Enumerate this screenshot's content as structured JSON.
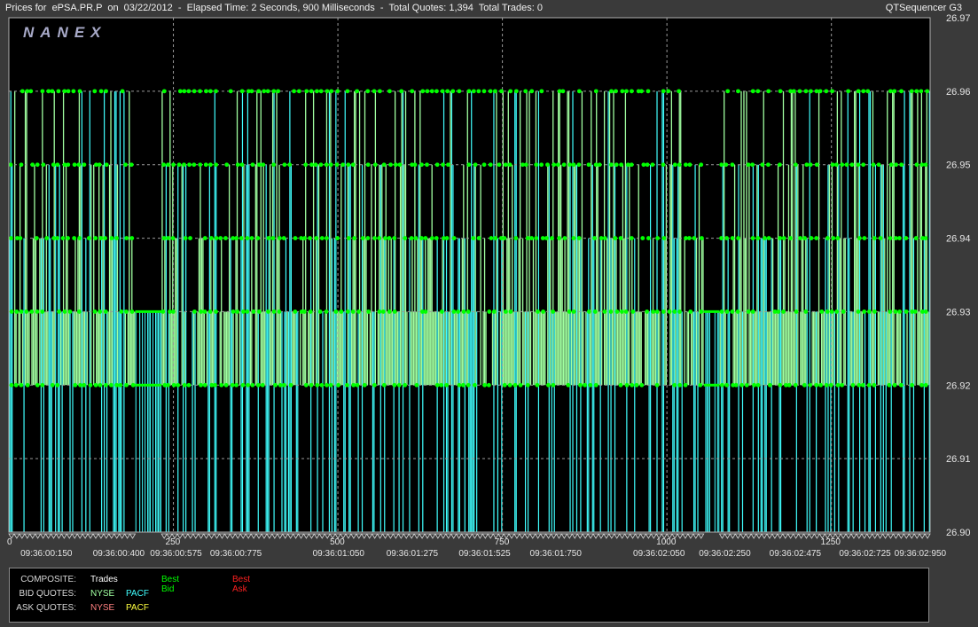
{
  "window": {
    "title": "Prices for  ePSA.PR.P  on  03/22/2012  -  Elapsed Time: 2 Seconds, 900 Milliseconds  -  Total Quotes: 1,394  Total Trades: 0",
    "app_name": "QTSequencer G3"
  },
  "logo_text": "NANEX",
  "colors": {
    "background": "#000000",
    "frame": "#3a3a3a",
    "best_bid": "#00ff00",
    "best_ask": "#ff2020",
    "bid_nyse": "#a0ffa0",
    "bid_pacf": "#40ffff",
    "ask_nyse": "#ff8080",
    "ask_pacf": "#ffff40",
    "grid": "#9a9a9a"
  },
  "chart_data": {
    "type": "line",
    "title": "Prices for  ePSA.PR.P  on  03/22/2012",
    "ylim": [
      26.9,
      26.97
    ],
    "xlim": [
      0,
      1400
    ],
    "y_ticks": [
      "26.97",
      "26.96",
      "26.95",
      "26.94",
      "26.93",
      "26.92",
      "26.91",
      "26.90"
    ],
    "y_tick_values": [
      26.97,
      26.96,
      26.95,
      26.94,
      26.93,
      26.92,
      26.91,
      26.9
    ],
    "x_ticks": [
      "0",
      "250",
      "500",
      "750",
      "1000",
      "1250"
    ],
    "x_tick_values": [
      0,
      250,
      500,
      750,
      1000,
      1250
    ],
    "time_labels": [
      "09:36:00:150",
      "09:36:00:400",
      "09:36:00:575",
      "09:36:00:775",
      "09:36:01:050",
      "09:36:01:275",
      "09:36:01:525",
      "09:36:01:750",
      "09:36:02:050",
      "09:36:02:250",
      "09:36:02:475",
      "09:36:02:725",
      "09:36:02:950"
    ],
    "time_label_positions": [
      57,
      167,
      254,
      345,
      501,
      613,
      723,
      831,
      988,
      1088,
      1195,
      1301,
      1385
    ],
    "best_bid_levels": [
      26.92,
      26.93
    ],
    "quote_levels": [
      26.92,
      26.93,
      26.94,
      26.95,
      26.96
    ],
    "gaps": [
      [
        192,
        232
      ],
      [
        1056,
        1080
      ]
    ],
    "quote_count": 1394,
    "trade_count": 0
  },
  "legend": {
    "composite_label": "COMPOSITE:",
    "bid_label": "BID QUOTES:",
    "ask_label": "ASK QUOTES:",
    "trades": "Trades",
    "best_bid": "Best Bid",
    "best_ask": "Best Ask",
    "bid_nyse": "NYSE",
    "bid_pacf": "PACF",
    "ask_nyse": "NYSE",
    "ask_pacf": "PACF"
  }
}
